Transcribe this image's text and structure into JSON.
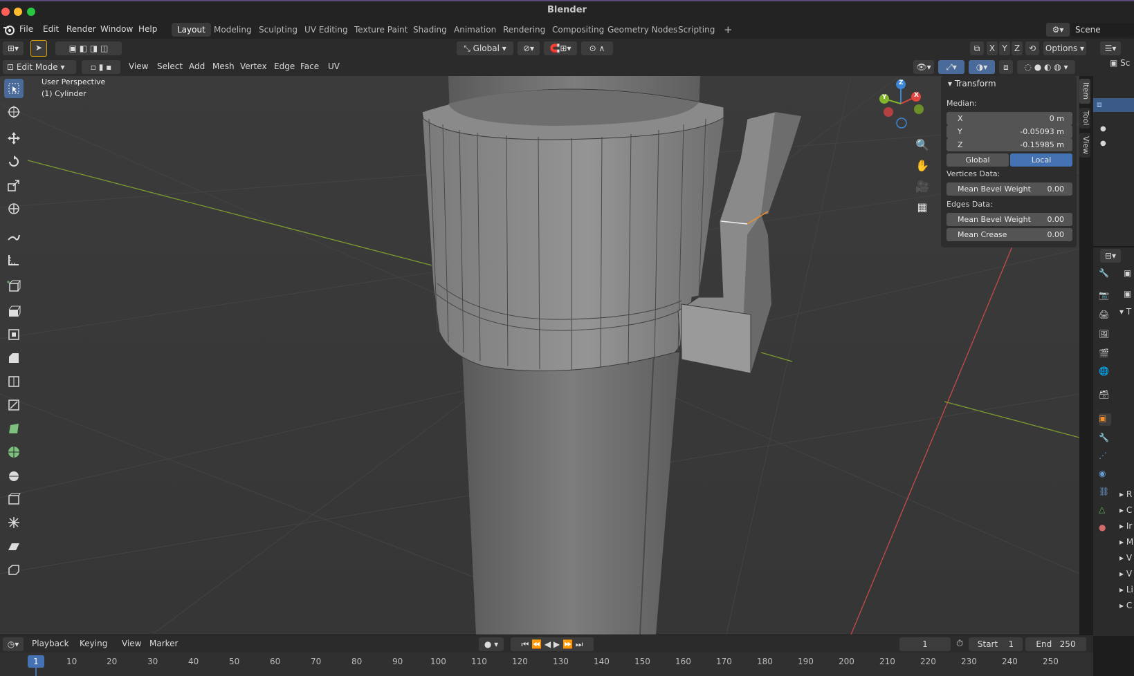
{
  "window": {
    "title": "Blender"
  },
  "menu": {
    "items": [
      "File",
      "Edit",
      "Render",
      "Window",
      "Help"
    ],
    "workspaces": [
      "Layout",
      "Modeling",
      "Sculpting",
      "UV Editing",
      "Texture Paint",
      "Shading",
      "Animation",
      "Rendering",
      "Compositing",
      "Geometry Nodes",
      "Scripting"
    ],
    "active_workspace": "Layout",
    "add_tab": "+",
    "scene_label": "Scene"
  },
  "header": {
    "orientation": "Global",
    "axes": [
      "X",
      "Y",
      "Z"
    ],
    "options_label": "Options",
    "mode": "Edit Mode",
    "menus": [
      "View",
      "Select",
      "Add",
      "Mesh",
      "Vertex",
      "Edge",
      "Face",
      "UV"
    ]
  },
  "viewport": {
    "perspective_label": "User Perspective",
    "object_label": "(1) Cylinder",
    "gizmo_axes": [
      "Z",
      "X",
      "Y"
    ],
    "colors": {
      "x": "#e0463f",
      "y": "#82b52b",
      "z": "#3b86d6",
      "selection": "#f28f2b"
    }
  },
  "side_tabs": [
    "Item",
    "Tool",
    "View"
  ],
  "transform_panel": {
    "title": "Transform",
    "median_label": "Median:",
    "x_label": "X",
    "x_value": "0 m",
    "y_label": "Y",
    "y_value": "-0.05093 m",
    "z_label": "Z",
    "z_value": "-0.15985 m",
    "global_label": "Global",
    "local_label": "Local",
    "vertices_label": "Vertices Data:",
    "vertex_bevel_label": "Mean Bevel Weight",
    "vertex_bevel_value": "0.00",
    "edges_label": "Edges Data:",
    "edge_bevel_label": "Mean Bevel Weight",
    "edge_bevel_value": "0.00",
    "crease_label": "Mean Crease",
    "crease_value": "0.00"
  },
  "timeline": {
    "menus": [
      "Playback",
      "Keying",
      "View",
      "Marker"
    ],
    "current_frame": "1",
    "start_label": "Start",
    "start_value": "1",
    "end_label": "End",
    "end_value": "250",
    "ticks": [
      "10",
      "20",
      "30",
      "40",
      "50",
      "60",
      "70",
      "80",
      "90",
      "100",
      "110",
      "120",
      "130",
      "140",
      "150",
      "160",
      "170",
      "180",
      "190",
      "200",
      "210",
      "220",
      "230",
      "240",
      "250"
    ],
    "playhead": "1"
  },
  "properties_partial": [
    "T",
    "R",
    "C",
    "Ir",
    "M",
    "V",
    "V",
    "Li",
    "C"
  ],
  "outliner_partial": "Sc"
}
